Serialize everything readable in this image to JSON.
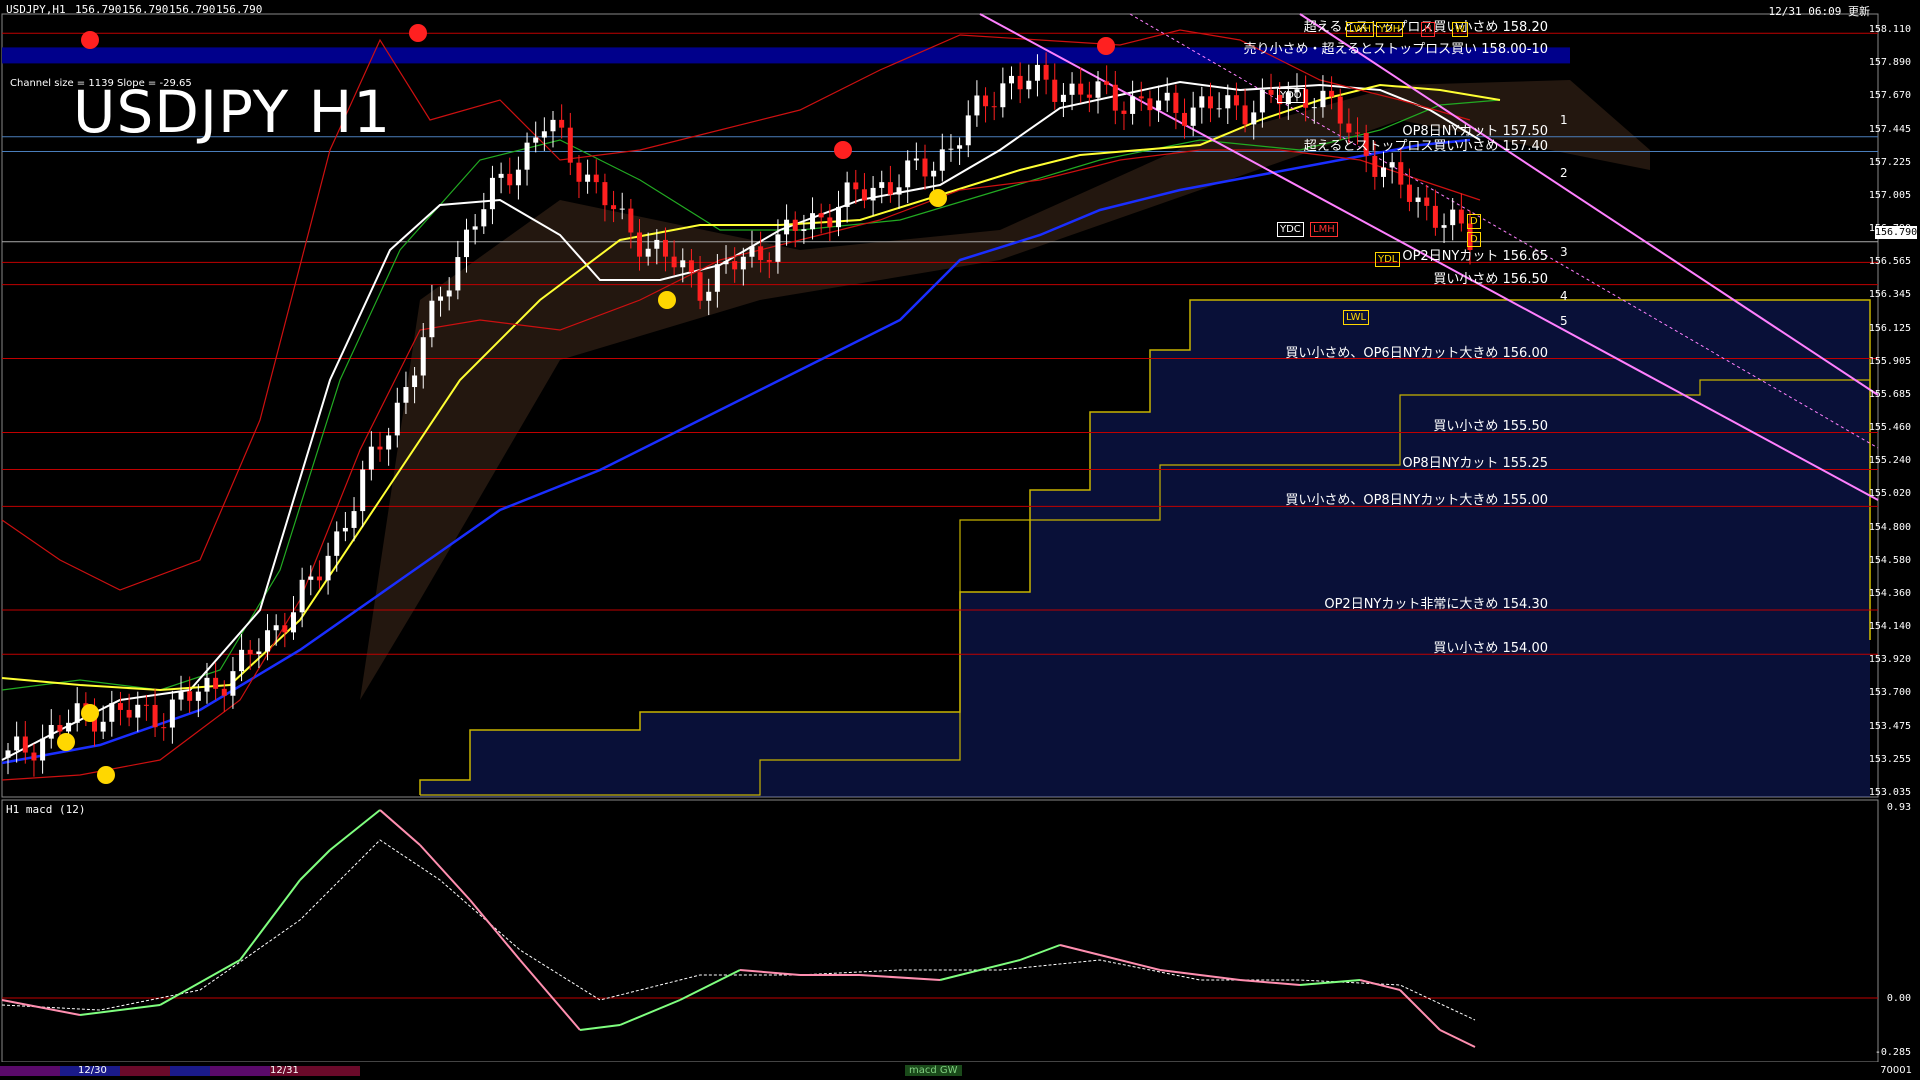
{
  "header": {
    "symbol_info": "USDJPY,H1",
    "ohlc": [
      "156.790",
      "156.790",
      "156.790",
      "156.790"
    ],
    "update_time": "12/31 06:09 更新"
  },
  "title_overlay": "USDJPY H1",
  "channel_info": "Channel size = 1139 Slope = -29.65",
  "current_price": "156.790",
  "price_axis": [
    "158.110",
    "157.890",
    "157.670",
    "157.445",
    "157.225",
    "157.005",
    "156.790",
    "156.565",
    "156.345",
    "156.125",
    "155.905",
    "155.685",
    "155.460",
    "155.240",
    "155.020",
    "154.800",
    "154.580",
    "154.360",
    "154.140",
    "153.920",
    "153.700",
    "153.475",
    "153.255",
    "153.035"
  ],
  "levels": [
    {
      "text": "超えるとストップロス買い小さめ 158.20",
      "price": 158.2,
      "color": "#c00000"
    },
    {
      "text": "売り小さめ・超えるとストップロス買い 158.00-10",
      "price": 158.05,
      "color": "#00008b",
      "band": true
    },
    {
      "text": "OP8日NYカット 157.50",
      "price": 157.5,
      "color": "#4a7ebb"
    },
    {
      "text": "超えるとストップロス買い小さめ 157.40",
      "price": 157.4,
      "color": "#4a7ebb"
    },
    {
      "text": "OP2日NYカット 156.65",
      "price": 156.65,
      "color": "#c00000"
    },
    {
      "text": "買い小さめ 156.50",
      "price": 156.5,
      "color": "#c00000"
    },
    {
      "text": "買い小さめ、OP6日NYカット大きめ 156.00",
      "price": 156.0,
      "color": "#c00000"
    },
    {
      "text": "買い小さめ 155.50",
      "price": 155.5,
      "color": "#c00000"
    },
    {
      "text": "OP8日NYカット 155.25",
      "price": 155.25,
      "color": "#c00000"
    },
    {
      "text": "買い小さめ、OP8日NYカット大きめ 155.00",
      "price": 155.0,
      "color": "#c00000"
    },
    {
      "text": "OP2日NYカット非常に大きめ 154.30",
      "price": 154.3,
      "color": "#c00000"
    },
    {
      "text": "買い小さめ 154.00",
      "price": 154.0,
      "color": "#c00000"
    }
  ],
  "tags": [
    {
      "text": "LWH",
      "style": "y"
    },
    {
      "text": "YDH",
      "style": "y"
    },
    {
      "text": "H",
      "style": "r"
    },
    {
      "text": "W",
      "style": "y"
    },
    {
      "text": "YDO",
      "style": "w"
    },
    {
      "text": "YDC",
      "style": "w"
    },
    {
      "text": "LMH",
      "style": "r"
    },
    {
      "text": "YDL",
      "style": "y"
    },
    {
      "text": "LWL",
      "style": "y"
    },
    {
      "text": "D",
      "style": "y"
    },
    {
      "text": "D",
      "style": "y"
    }
  ],
  "channel_numbers": [
    "1",
    "2",
    "3",
    "4",
    "5"
  ],
  "macd": {
    "label": "H1  macd (12)",
    "axis": [
      "0.93",
      "0.00",
      "-0.285"
    ]
  },
  "bottom": {
    "dates": [
      "12/30",
      "12/31"
    ],
    "indicator": "macd GW",
    "right_text": "70001"
  },
  "colors": {
    "background": "#000000",
    "bull": "#ffffff",
    "bear": "#ff2020",
    "ma_white": "#ffffff",
    "ma_yellow": "#ffff33",
    "ma_blue": "#1a2eff",
    "channel": "#ff80ff",
    "cloud": "#2a4aff",
    "chikou": "#22aa22",
    "macd_up": "#7fff7f",
    "macd_down": "#ff8fb0"
  },
  "chart_data": {
    "type": "line",
    "title": "USDJPY H1",
    "xlabel": "",
    "ylabel": "",
    "ylim": [
      153.035,
      158.33
    ],
    "x": [
      "12/30",
      "12/31"
    ],
    "series": [
      {
        "name": "USDJPY H1 close (approx)",
        "values": [
          153.3,
          153.6,
          153.6,
          153.9,
          154.5,
          155.6,
          156.9,
          157.6,
          156.9,
          156.5,
          156.8,
          157.1,
          157.3,
          157.9,
          157.8,
          157.7,
          157.7,
          157.8,
          157.2,
          156.8
        ]
      }
    ]
  }
}
